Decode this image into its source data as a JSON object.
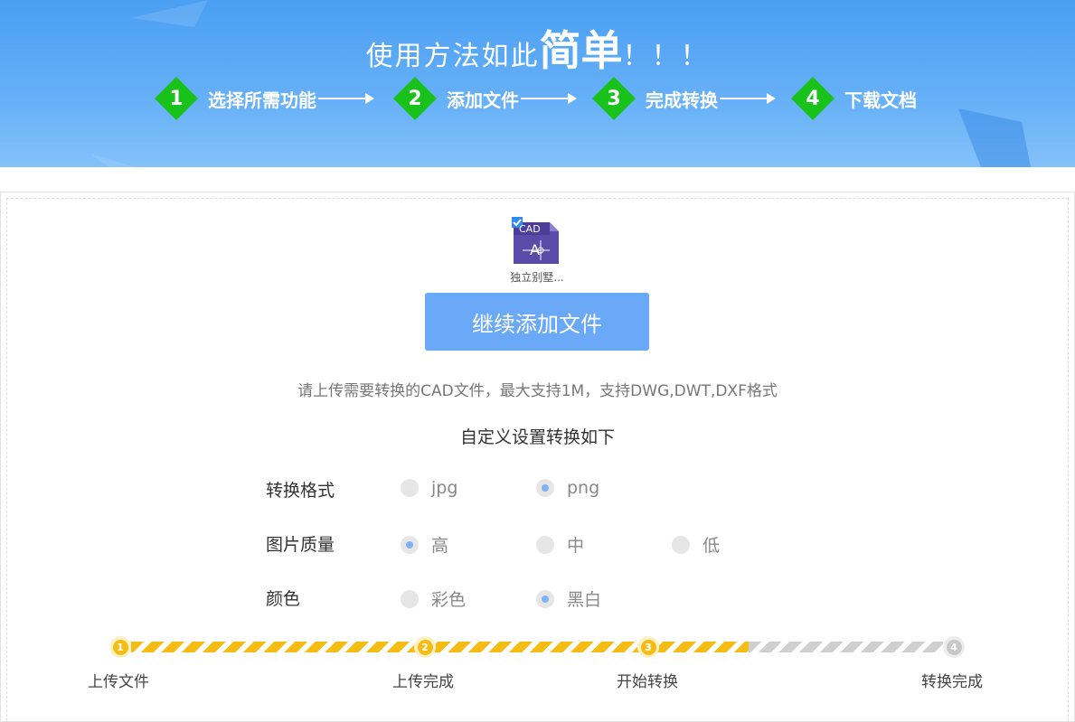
{
  "banner": {
    "title_prefix": "使用方法如此",
    "title_highlight": "简单",
    "title_suffix": "！！！",
    "steps": [
      {
        "num": "1",
        "label": "选择所需功能"
      },
      {
        "num": "2",
        "label": "添加文件"
      },
      {
        "num": "3",
        "label": "完成转换"
      },
      {
        "num": "4",
        "label": "下载文档"
      }
    ]
  },
  "file": {
    "badge": "CAD",
    "name": "独立别墅..."
  },
  "add_button": "继续添加文件",
  "hint": "请上传需要转换的CAD文件，最大支持1M，支持DWG,DWT,DXF格式",
  "settings": {
    "title": "自定义设置转换如下",
    "format": {
      "label": "转换格式",
      "options": [
        "jpg",
        "png"
      ],
      "selected": "png"
    },
    "quality": {
      "label": "图片质量",
      "options": [
        "高",
        "中",
        "低"
      ],
      "selected": "高"
    },
    "color": {
      "label": "颜色",
      "options": [
        "彩色",
        "黑白"
      ],
      "selected": "黑白"
    }
  },
  "progress": {
    "steps": [
      {
        "num": "1",
        "label": "上传文件",
        "state": "done"
      },
      {
        "num": "2",
        "label": "上传完成",
        "state": "done"
      },
      {
        "num": "3",
        "label": "开始转换",
        "state": "done"
      },
      {
        "num": "4",
        "label": "转换完成",
        "state": "todo"
      }
    ],
    "fraction_complete": 0.67
  },
  "colors": {
    "banner_blue": "#4a9ff3",
    "step_green": "#19c21b",
    "button_blue": "#6aa9f7",
    "progress_yellow": "#f5bd14"
  }
}
